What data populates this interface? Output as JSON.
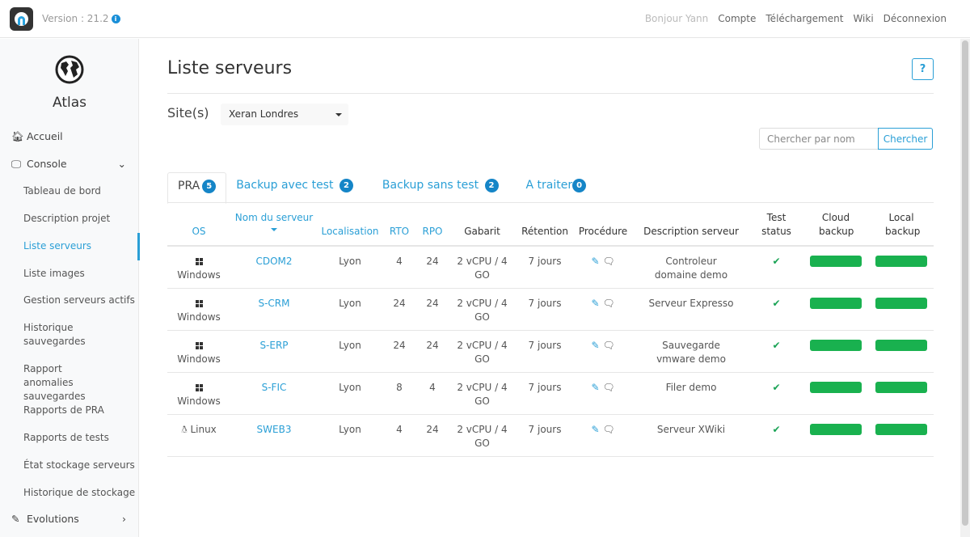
{
  "header": {
    "version": "Version : 21.2",
    "links": {
      "greeting": "Bonjour Yann",
      "account": "Compte",
      "download": "Téléchargement",
      "wiki": "Wiki",
      "logout": "Déconnexion"
    }
  },
  "sidebar": {
    "app_name": "Atlas",
    "home": "Accueil",
    "console": "Console",
    "items": [
      "Tableau de bord",
      "Description projet",
      "Liste serveurs",
      "Liste images",
      "Gestion serveurs actifs",
      "Historique sauvegardes",
      "Rapport anomalies sauvegardes",
      "Rapports de PRA",
      "Rapports de tests",
      "État stockage serveurs",
      "Historique de stockage"
    ],
    "evolutions": "Evolutions"
  },
  "main": {
    "title": "Liste serveurs",
    "help": "?",
    "site_label": "Site(s)",
    "site_value": "Xeran Londres",
    "search_placeholder": "Chercher par nom",
    "search_button": "Chercher",
    "tabs": [
      {
        "label": "PRA",
        "count": "5"
      },
      {
        "label": "Backup avec test",
        "count": "2"
      },
      {
        "label": "Backup sans test",
        "count": "2"
      },
      {
        "label": "A traiter",
        "count": "0"
      }
    ],
    "columns": [
      "OS",
      "Nom du serveur",
      "Localisation",
      "RTO",
      "RPO",
      "Gabarit",
      "Rétention",
      "Procédure",
      "Description serveur",
      "Test status",
      "Cloud backup",
      "Local backup"
    ],
    "rows": [
      {
        "os": "Windows",
        "name": "CDOM2",
        "loc": "Lyon",
        "rto": "4",
        "rpo": "24",
        "gabarit": "2 vCPU / 4 GO",
        "retention": "7 jours",
        "desc": "Controleur domaine demo",
        "test": "✔"
      },
      {
        "os": "Windows",
        "name": "S-CRM",
        "loc": "Lyon",
        "rto": "24",
        "rpo": "24",
        "gabarit": "2 vCPU / 4 GO",
        "retention": "7 jours",
        "desc": "Serveur Expresso",
        "test": "✔"
      },
      {
        "os": "Windows",
        "name": "S-ERP",
        "loc": "Lyon",
        "rto": "24",
        "rpo": "24",
        "gabarit": "2 vCPU / 4 GO",
        "retention": "7 jours",
        "desc": "Sauvegarde vmware demo",
        "test": "✔"
      },
      {
        "os": "Windows",
        "name": "S-FIC",
        "loc": "Lyon",
        "rto": "8",
        "rpo": "4",
        "gabarit": "2 vCPU / 4 GO",
        "retention": "7 jours",
        "desc": "Filer demo",
        "test": "✔"
      },
      {
        "os": "Linux",
        "name": "SWEB3",
        "loc": "Lyon",
        "rto": "4",
        "rpo": "24",
        "gabarit": "2 vCPU / 4 GO",
        "retention": "7 jours",
        "desc": "Serveur XWiki",
        "test": "✔"
      }
    ]
  },
  "colors": {
    "accent": "#2a9fd6",
    "success": "#19b14f"
  }
}
